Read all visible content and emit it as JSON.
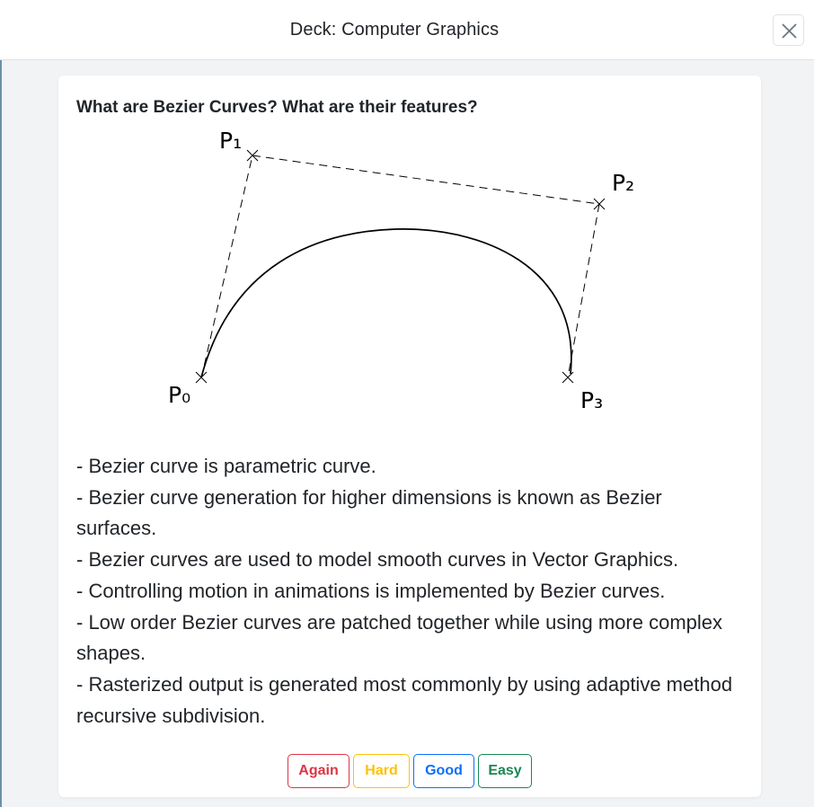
{
  "header": {
    "title": "Deck: Computer Graphics",
    "close_icon": "close-icon"
  },
  "card": {
    "question": "What are Bezier Curves? What are their features?",
    "figure": {
      "labels": {
        "p0": "P₀",
        "p1": "P₁",
        "p2": "P₂",
        "p3": "P₃"
      }
    },
    "answer_lines": [
      "- Bezier curve is parametric curve.",
      "- Bezier curve generation for higher dimensions is known as Bezier surfaces.",
      "- Bezier curves are used to model smooth curves in Vector Graphics.",
      "- Controlling motion in animations is implemented by Bezier curves.",
      "- Low order Bezier curves are patched together while using more complex shapes.",
      "- Rasterized output is generated most commonly by using adaptive method recursive subdivision."
    ]
  },
  "rating": {
    "again": "Again",
    "hard": "Hard",
    "good": "Good",
    "easy": "Easy"
  },
  "colors": {
    "again": "#dc3545",
    "hard": "#ffc107",
    "good": "#0d6efd",
    "easy": "#198754"
  }
}
